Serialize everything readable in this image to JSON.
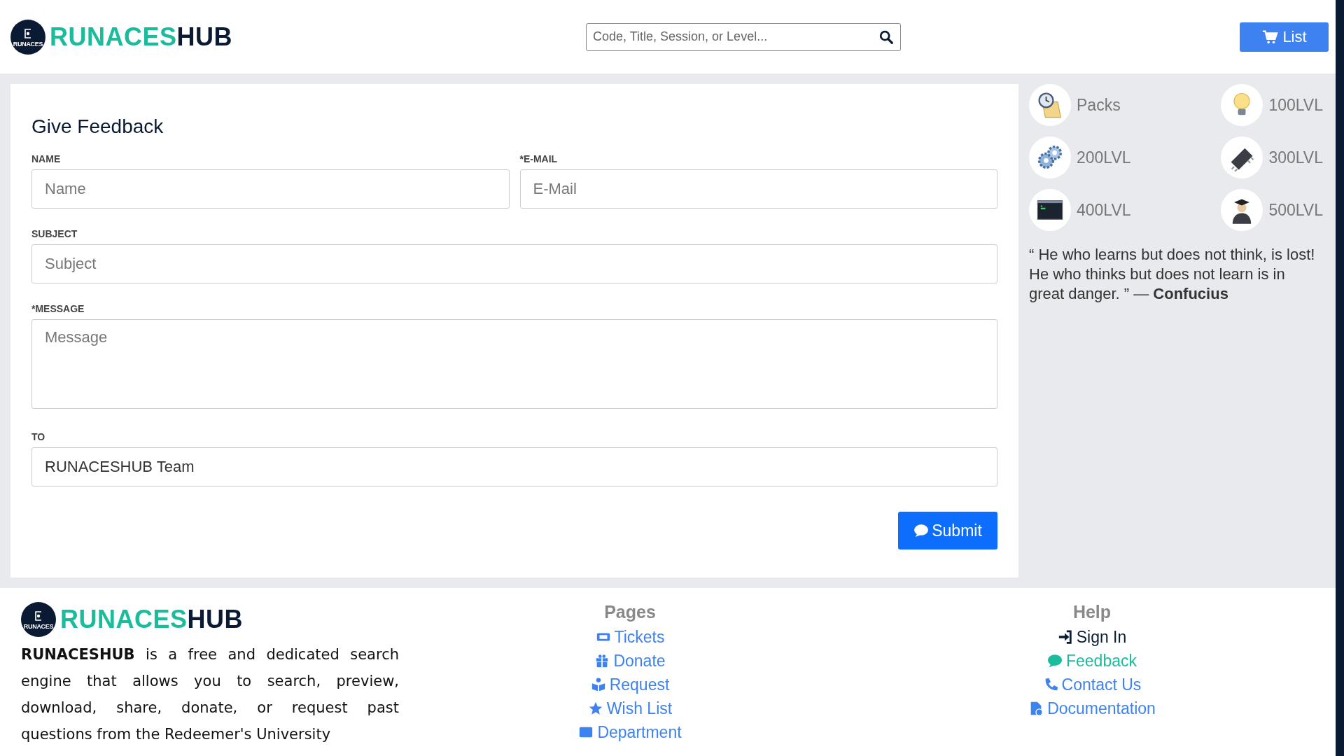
{
  "header": {
    "logo": {
      "badge": "RUNACES",
      "brand_part_1": "RUNACES",
      "brand_part_2": "HUB"
    },
    "search": {
      "placeholder": "Code, Title, Session, or Level..."
    },
    "list_button": "List"
  },
  "form": {
    "title": "Give Feedback",
    "fields": [
      {
        "label": "NAME",
        "placeholder": "Name",
        "kind": "input"
      },
      {
        "label": "*E-MAIL",
        "placeholder": "E-Mail",
        "kind": "input"
      },
      {
        "label": "SUBJECT",
        "placeholder": "Subject",
        "kind": "input"
      },
      {
        "label": "*MESSAGE",
        "placeholder": "Message",
        "kind": "textarea"
      },
      {
        "label": "TO",
        "value": "RUNACESHUB Team",
        "kind": "input"
      }
    ],
    "submit": "Submit"
  },
  "sidebar": {
    "categories": [
      {
        "label": "Packs",
        "kind": "scroll"
      },
      {
        "label": "100LVL",
        "kind": "bulb"
      },
      {
        "label": "200LVL",
        "kind": "gears"
      },
      {
        "label": "300LVL",
        "kind": "chip"
      },
      {
        "label": "400LVL",
        "kind": "terminal"
      },
      {
        "label": "500LVL",
        "kind": "graduate"
      }
    ],
    "quote": {
      "text": "“ He who learns but does not think, is lost! He who thinks but does not learn is in great danger. ” — **Confucius**"
    }
  },
  "footer": {
    "logo": {
      "badge": "RUNACES",
      "brand_part_1": "RUNACES",
      "brand_part_2": "HUB"
    },
    "about": "**RUNACESHUB** is a free and dedicated search engine that allows you to search, preview, download, share, donate, or request past questions from the Redeemer's University",
    "pages": {
      "title": "Pages",
      "links": [
        {
          "label": "Tickets",
          "kind": "ticket"
        },
        {
          "label": "Donate",
          "kind": "gift"
        },
        {
          "label": "Request",
          "kind": "reader"
        },
        {
          "label": "Wish List",
          "kind": "star"
        },
        {
          "label": "Department",
          "kind": "card"
        }
      ]
    },
    "help": {
      "title": "Help",
      "links": [
        {
          "label": "Sign In",
          "kind": "signin",
          "color": "#0b1a33"
        },
        {
          "label": "Feedback",
          "kind": "comment",
          "color": "#1abc9c"
        },
        {
          "label": "Contact Us",
          "kind": "phone",
          "color": "#3d82f0"
        },
        {
          "label": "Documentation",
          "kind": "doc",
          "color": "#3d82f0"
        }
      ]
    }
  }
}
